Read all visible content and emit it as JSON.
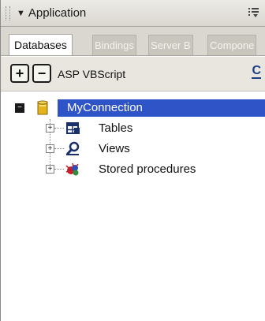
{
  "panel": {
    "title": "Application"
  },
  "tabs": [
    {
      "label": "Databases",
      "active": true
    },
    {
      "label": "Bindings",
      "active": false
    },
    {
      "label": "Server B",
      "active": false
    },
    {
      "label": "Compone",
      "active": false
    }
  ],
  "toolbar": {
    "add_label": "+",
    "remove_label": "−",
    "server_model": "ASP VBScript",
    "refresh_label": "C"
  },
  "tree": {
    "connection": {
      "label": "MyConnection",
      "icon": "database-cylinder-icon",
      "expanded": true,
      "selected": true
    },
    "children": [
      {
        "label": "Tables",
        "icon": "table-icon"
      },
      {
        "label": "Views",
        "icon": "magnifier-view-icon"
      },
      {
        "label": "Stored procedures",
        "icon": "stored-procedure-icon"
      }
    ]
  },
  "colors": {
    "selection": "#2f54c8",
    "panel_header": "#d9d7cf",
    "toolbar": "#e8e6df"
  }
}
